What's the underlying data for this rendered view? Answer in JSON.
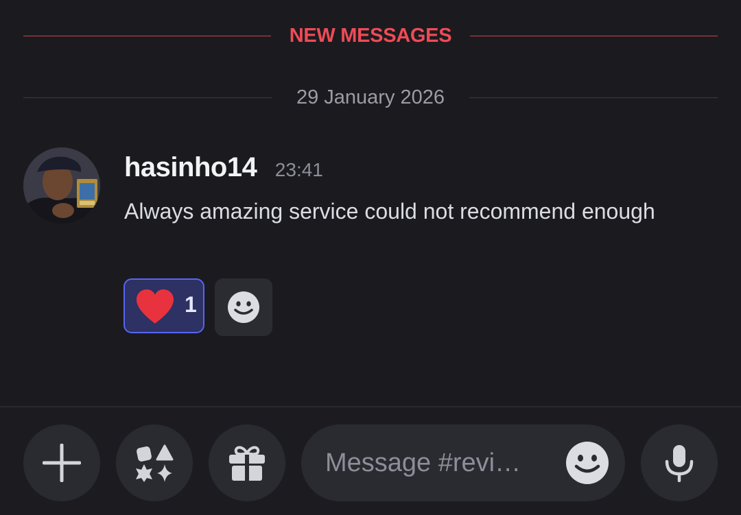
{
  "dividers": {
    "new_messages": "NEW MESSAGES",
    "date": "29 January 2026"
  },
  "message": {
    "author": "hasinho14",
    "timestamp": "23:41",
    "text": "Always amazing service could not recommend enough",
    "reactions": [
      {
        "emoji": "heart-icon",
        "count": "1",
        "selected": true
      }
    ]
  },
  "composer": {
    "placeholder": "Message #revi…"
  },
  "colors": {
    "background": "#1b1b1f",
    "new_messages_red": "#ee4b56",
    "blurple": "#5865f2",
    "heart": "#e8333f"
  }
}
